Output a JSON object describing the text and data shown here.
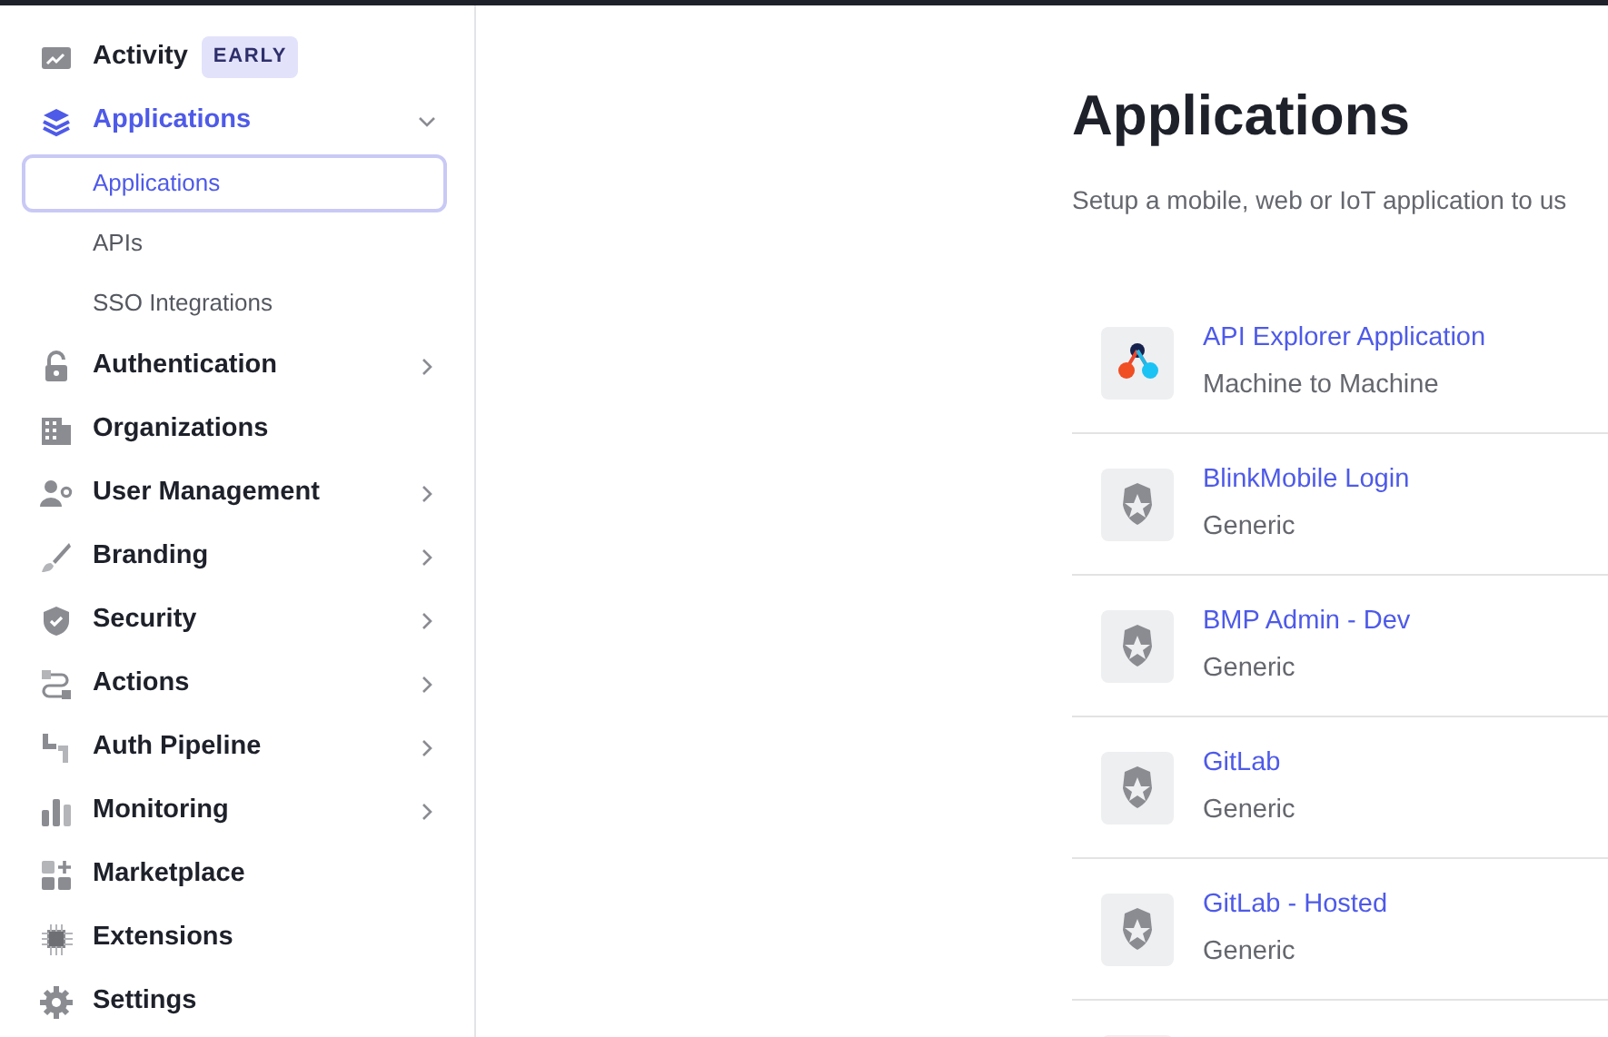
{
  "sidebar": {
    "items": [
      {
        "label": "Activity",
        "kind": "activity",
        "badge": "EARLY",
        "selected": false
      },
      {
        "label": "Applications",
        "kind": "layers",
        "expanded": true,
        "selected": true,
        "children": [
          {
            "label": "Applications",
            "selected": true
          },
          {
            "label": "APIs",
            "selected": false
          },
          {
            "label": "SSO Integrations",
            "selected": false
          }
        ]
      },
      {
        "label": "Authentication",
        "kind": "lock",
        "expanded": false,
        "selected": false
      },
      {
        "label": "Organizations",
        "kind": "building",
        "selected": false
      },
      {
        "label": "User Management",
        "kind": "users",
        "expanded": false,
        "selected": false
      },
      {
        "label": "Branding",
        "kind": "brush",
        "expanded": false,
        "selected": false
      },
      {
        "label": "Security",
        "kind": "shield",
        "expanded": false,
        "selected": false
      },
      {
        "label": "Actions",
        "kind": "flow",
        "expanded": false,
        "selected": false
      },
      {
        "label": "Auth Pipeline",
        "kind": "pipe",
        "expanded": false,
        "selected": false
      },
      {
        "label": "Monitoring",
        "kind": "bars",
        "expanded": false,
        "selected": false
      },
      {
        "label": "Marketplace",
        "kind": "market",
        "selected": false
      },
      {
        "label": "Extensions",
        "kind": "chip",
        "selected": false
      },
      {
        "label": "Settings",
        "kind": "gear",
        "selected": false
      }
    ]
  },
  "page": {
    "title": "Applications",
    "subtitle": "Setup a mobile, web or IoT application to us"
  },
  "applications": [
    {
      "name": "API Explorer Application",
      "type": "Machine to Machine",
      "kind": "explorer"
    },
    {
      "name": "BlinkMobile Login",
      "type": "Generic",
      "kind": "badge"
    },
    {
      "name": "BMP Admin - Dev",
      "type": "Generic",
      "kind": "badge"
    },
    {
      "name": "GitLab",
      "type": "Generic",
      "kind": "badge"
    },
    {
      "name": "GitLab - Hosted",
      "type": "Generic",
      "kind": "badge"
    },
    {
      "kind": "blank"
    }
  ]
}
